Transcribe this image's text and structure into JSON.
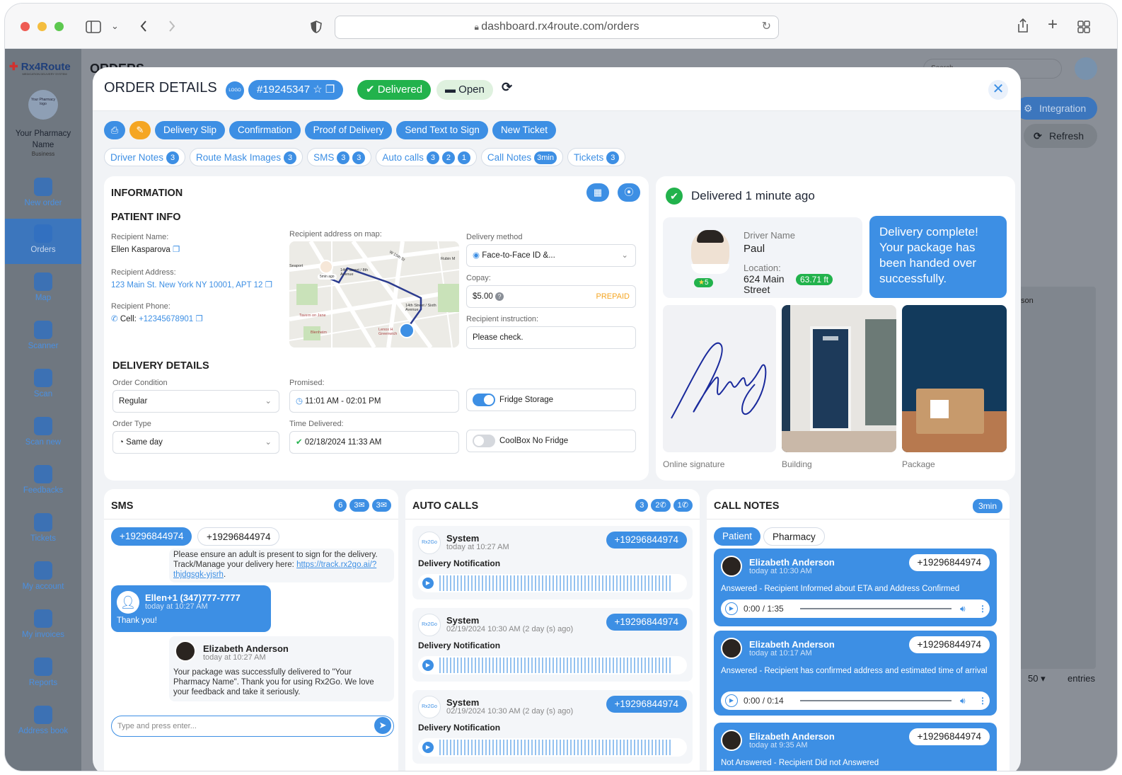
{
  "browser": {
    "url": "dashboard.rx4route.com/orders"
  },
  "app": {
    "brand": "Rx4Route",
    "brand_tagline": "MEDICATION DELIVERY SYSTEM",
    "pharmacy_logo_text": "Your Pharmacy logo",
    "pharmacy_name": "Your Pharmacy Name",
    "pharmacy_sub": "Business",
    "page_title": "ORDERS",
    "search_placeholder": "Search",
    "right_buttons": {
      "integration": "Integration",
      "refresh": "Refresh"
    },
    "entries_count": "50",
    "entries_label": "entries",
    "behind_col": "son"
  },
  "sidebar": {
    "items": [
      {
        "label": "New order",
        "icon": "new-order-icon"
      },
      {
        "label": "Orders",
        "icon": "clipboard-icon"
      },
      {
        "label": "Map",
        "icon": "map-pin-icon"
      },
      {
        "label": "Scanner",
        "icon": "barcode-icon"
      },
      {
        "label": "Scan",
        "icon": "barcode-icon"
      },
      {
        "label": "Scan new",
        "icon": "barcode-icon"
      },
      {
        "label": "Feedbacks",
        "icon": "chat-icon"
      },
      {
        "label": "Tickets",
        "icon": "ticket-icon"
      },
      {
        "label": "My account",
        "icon": "gear-icon"
      },
      {
        "label": "My invoices",
        "icon": "invoice-icon"
      },
      {
        "label": "Reports",
        "icon": "reports-icon"
      },
      {
        "label": "Address book",
        "icon": "address-book-icon"
      }
    ]
  },
  "modal": {
    "title": "ORDER DETAILS",
    "logo_text": "LOGO",
    "order_id": "#19245347",
    "status_delivered": "Delivered",
    "status_open": "Open",
    "actions": [
      "Delivery Slip",
      "Confirmation",
      "Proof of Delivery",
      "Send Text to Sign",
      "New Ticket"
    ],
    "tabs": [
      {
        "label": "Driver Notes",
        "counts": [
          "3"
        ]
      },
      {
        "label": "Route Mask Images",
        "counts": [
          "3"
        ]
      },
      {
        "label": "SMS",
        "counts": [
          "3",
          "3"
        ]
      },
      {
        "label": "Auto calls",
        "counts": [
          "3",
          "2",
          "1"
        ]
      },
      {
        "label": "Call Notes",
        "counts": [
          "3min"
        ]
      },
      {
        "label": "Tickets",
        "counts": [
          "3"
        ]
      }
    ]
  },
  "info": {
    "heading": "INFORMATION",
    "patient_heading": "PATIENT INFO",
    "recipient_name_label": "Recipient Name:",
    "recipient_name": "Ellen Kasparova",
    "recipient_address_label": "Recipient Address:",
    "recipient_address": "123 Main St. New York NY 10001, APT 12",
    "recipient_phone_label": "Recipient Phone:",
    "cell_label": "Cell:",
    "cell": "+12345678901",
    "map_label": "Recipient address on map:",
    "map_streets": [
      "W 15th St",
      "Rubin M",
      "14th Street / 8th Avenue",
      "14th Street / Sixth Avenue",
      "Tavern on Jane",
      "Blenheim",
      "Lenox H Greenwich",
      "Seaport",
      "5min ago"
    ],
    "delivery_method_label": "Delivery method",
    "delivery_method": "Face-to-Face ID &...",
    "copay_label": "Copay:",
    "copay": "$5.00",
    "copay_status": "PREPAID",
    "instruction_label": "Recipient instruction:",
    "instruction": "Please check.",
    "delivery_heading": "DELIVERY DETAILS",
    "order_condition_label": "Order Condition",
    "order_condition": "Regular",
    "order_type_label": "Order Type",
    "order_type": "Same day",
    "promised_label": "Promised:",
    "promised": "11:01 AM - 02:01 PM",
    "time_delivered_label": "Time Delivered:",
    "time_delivered": "02/18/2024 11:33 AM",
    "fridge": "Fridge Storage",
    "coolbox": "CoolBox No Fridge"
  },
  "delivery": {
    "headline": "Delivered 1 minute ago",
    "driver_name_label": "Driver Name",
    "driver_name": "Paul",
    "rating": "5",
    "location_label": "Location:",
    "location": "624 Main Street",
    "distance": "63.71 ft",
    "message": "Delivery complete! Your package has been handed over successfully.",
    "photos": [
      "Online signature",
      "Building",
      "Package"
    ]
  },
  "sms": {
    "heading": "SMS",
    "counts": [
      "6",
      "3",
      "3"
    ],
    "numbers": [
      "+19296844974",
      "+19296844974"
    ],
    "msg1": "Please ensure an adult is present to sign for the delivery. Track/Manage your delivery here: ",
    "msg1_link": "https://track.rx2go.ai/?thjdgsgk-yjsrh",
    "msg2_name": "Ellen+1 (347)777-7777",
    "msg2_time": "today at 10:27 AM",
    "msg2_text": "Thank you!",
    "msg3_name": "Elizabeth Anderson",
    "msg3_time": "today at 10:27 AM",
    "msg3_text": "Your package was successfully delivered to \"Your Pharmacy Name\". Thank you for using Rx2Go. We love your feedback and take it seriously.",
    "input_placeholder": "Type and press enter..."
  },
  "auto_calls": {
    "heading": "AUTO CALLS",
    "counts": [
      "3",
      "2",
      "1"
    ],
    "items": [
      {
        "name": "System",
        "time": "today at 10:27 AM",
        "phone": "+19296844974",
        "title": "Delivery Notification"
      },
      {
        "name": "System",
        "time": "02/19/2024 10:30 AM (2 day (s) ago)",
        "phone": "+19296844974",
        "title": "Delivery Notification"
      },
      {
        "name": "System",
        "time": "02/19/2024 10:30 AM (2 day (s) ago)",
        "phone": "+19296844974",
        "title": "Delivery Notification"
      }
    ]
  },
  "call_notes": {
    "heading": "CALL NOTES",
    "duration": "3min",
    "tabs": [
      "Patient",
      "Pharmacy"
    ],
    "items": [
      {
        "name": "Elizabeth Anderson",
        "time": "today at 10:30 AM",
        "phone": "+19296844974",
        "note": "Answered - Recipient Informed about ETA and Address Confirmed",
        "player": "0:00 / 1:35"
      },
      {
        "name": "Elizabeth Anderson",
        "time": "today at 10:17 AM",
        "phone": "+19296844974",
        "note": "Answered - Recipient has confirmed address and estimated time of arrival",
        "player": "0:00 / 0:14"
      },
      {
        "name": "Elizabeth Anderson",
        "time": "today at 9:35 AM",
        "phone": "+19296844974",
        "note": "Not Answered - Recipient Did not Answered"
      }
    ]
  },
  "colors": {
    "accent": "#3d8fe4",
    "success": "#22b24c",
    "warning": "#f5a623"
  }
}
